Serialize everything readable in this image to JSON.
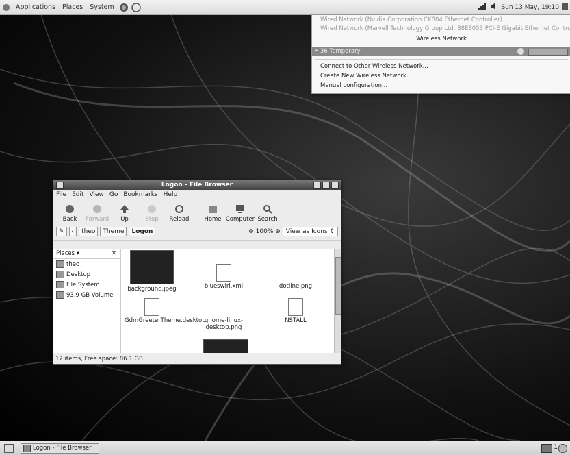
{
  "top_panel": {
    "menus": [
      "Applications",
      "Places",
      "System"
    ],
    "clock": "Sun 13 May, 19:10"
  },
  "network_menu": {
    "wired1": "Wired Network (Nvidia Corporation CK804 Ethernet Controller)",
    "wired2": "Wired Network (Marvell Technology Group Ltd. 88E8053 PCI-E Gigabit Ethernet Controller)",
    "wireless_header": "Wireless Network",
    "selected_network": "36 Temporary",
    "connect_other": "Connect to Other Wireless Network...",
    "create_new": "Create New Wireless Network...",
    "manual_config": "Manual configuration..."
  },
  "file_browser": {
    "title": "Logon - File Browser",
    "menus": [
      "File",
      "Edit",
      "View",
      "Go",
      "Bookmarks",
      "Help"
    ],
    "toolbar": {
      "back": "Back",
      "forward": "Forward",
      "up": "Up",
      "stop": "Stop",
      "reload": "Reload",
      "home": "Home",
      "computer": "Computer",
      "search": "Search"
    },
    "breadcrumbs": [
      "theo",
      "Theme",
      "Logon"
    ],
    "zoom": "100%",
    "view_mode": "View as Icons",
    "places_label": "Places",
    "places": [
      "theo",
      "Desktop",
      "File System",
      "93.9 GB Volume"
    ],
    "files": [
      "background.jpeg",
      "blueswirl.xml",
      "dotline.png",
      "GdmGreeterTheme.desktop",
      "gnome-linux-desktop.png",
      "NSTALL"
    ],
    "status": "12 items, Free space: 86.1 GB"
  },
  "bottom_panel": {
    "task": "Logon - File Browser",
    "workspace": "1"
  }
}
